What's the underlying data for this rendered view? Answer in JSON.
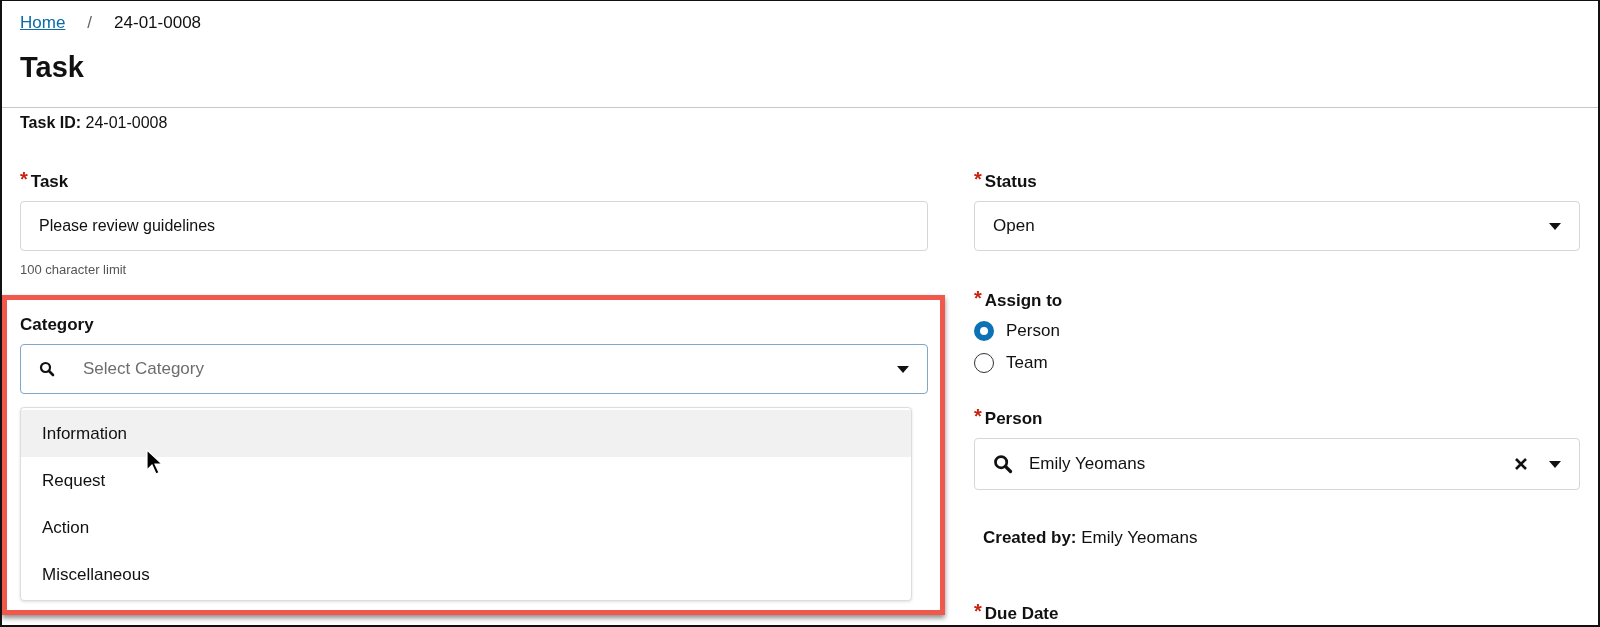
{
  "breadcrumb": [
    {
      "label": "Home",
      "kind": "link"
    },
    {
      "label": "24-01-0008",
      "kind": "current"
    }
  ],
  "breadcrumb_separator": "/",
  "title": "Task",
  "required_mark": "*",
  "task_id": {
    "label": "Task ID:",
    "value": "24-01-0008"
  },
  "task_field": {
    "label": "Task",
    "required": true,
    "value": "Please review guidelines",
    "hint": "100 character limit"
  },
  "category_field": {
    "label": "Category",
    "required": false,
    "placeholder": "Select Category",
    "expanded": true,
    "highlighted": true,
    "options": [
      {
        "label": "Information",
        "selected": true
      },
      {
        "label": "Request",
        "selected": false
      },
      {
        "label": "Action",
        "selected": false
      },
      {
        "label": "Miscellaneous",
        "selected": false
      }
    ]
  },
  "status_field": {
    "label": "Status",
    "required": true,
    "value": "Open"
  },
  "assign_to": {
    "label": "Assign to",
    "required": true,
    "options": [
      {
        "label": "Person",
        "selected": true
      },
      {
        "label": "Team",
        "selected": false
      }
    ]
  },
  "person_field": {
    "label": "Person",
    "required": true,
    "value": "Emily Yeomans",
    "clearable": true
  },
  "created_by": {
    "label": "Created by:",
    "value": "Emily Yeomans"
  },
  "due_date": {
    "label": "Due Date",
    "required": true
  }
}
